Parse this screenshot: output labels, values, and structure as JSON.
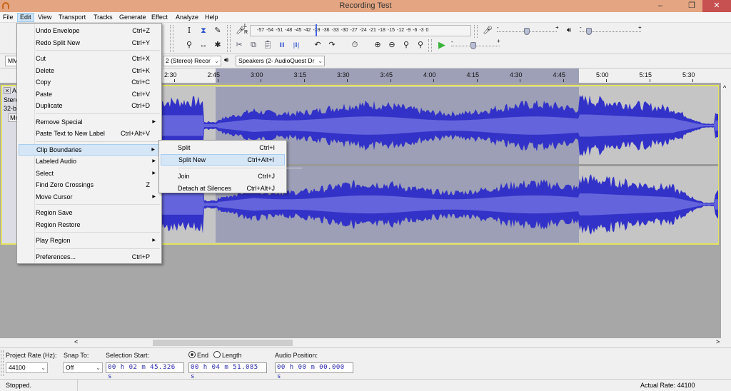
{
  "window": {
    "title": "Recording Test",
    "minimize": "–",
    "restore": "❐",
    "close": "✕"
  },
  "menubar": [
    "File",
    "Edit",
    "View",
    "Transport",
    "Tracks",
    "Generate",
    "Effect",
    "Analyze",
    "Help"
  ],
  "active_menu": "Edit",
  "edit_menu": {
    "items": [
      {
        "label": "Undo Envelope",
        "shortcut": "Ctrl+Z"
      },
      {
        "label": "Redo Split New",
        "shortcut": "Ctrl+Y"
      },
      {
        "label": "Cut",
        "shortcut": "Ctrl+X"
      },
      {
        "label": "Delete",
        "shortcut": "Ctrl+K"
      },
      {
        "label": "Copy",
        "shortcut": "Ctrl+C"
      },
      {
        "label": "Paste",
        "shortcut": "Ctrl+V"
      },
      {
        "label": "Duplicate",
        "shortcut": "Ctrl+D"
      },
      {
        "label": "Remove Special",
        "shortcut": "",
        "submenu": true
      },
      {
        "label": "Paste Text to New Label",
        "shortcut": "Ctrl+Alt+V"
      },
      {
        "label": "Clip Boundaries",
        "shortcut": "",
        "submenu": true,
        "highlighted": true
      },
      {
        "label": "Labeled Audio",
        "shortcut": "",
        "submenu": true
      },
      {
        "label": "Select",
        "shortcut": "",
        "submenu": true
      },
      {
        "label": "Find Zero Crossings",
        "shortcut": "Z"
      },
      {
        "label": "Move Cursor",
        "shortcut": "",
        "submenu": true
      },
      {
        "label": "Region Save",
        "shortcut": ""
      },
      {
        "label": "Region Restore",
        "shortcut": ""
      },
      {
        "label": "Play Region",
        "shortcut": "",
        "submenu": true
      },
      {
        "label": "Preferences...",
        "shortcut": "Ctrl+P"
      }
    ]
  },
  "clip_boundaries_submenu": {
    "items": [
      {
        "label": "Split",
        "shortcut": "Ctrl+I"
      },
      {
        "label": "Split New",
        "shortcut": "Ctrl+Alt+I",
        "highlighted": true
      },
      {
        "label": "Join",
        "shortcut": "Ctrl+J"
      },
      {
        "label": "Detach at Silences",
        "shortcut": "Ctrl+Alt+J"
      }
    ]
  },
  "toolbar": {
    "meter_scale": "-57 -54 -51 -48 -45 -42 -39 -36 -33 -30 -27 -24 -21 -18 -15 -12 -9 -6 -3 0",
    "meter_lr": {
      "l": "L",
      "r": "R"
    },
    "recording_volume": 0.5,
    "playback_volume": 0.15,
    "play_speed": 0.45,
    "slider_minus": "-",
    "slider_plus": "+"
  },
  "devices": {
    "host": "MM",
    "recording_channels": "2 (Stereo) Recor",
    "playback_device": "Speakers (2- AudioQuest Dr"
  },
  "ruler": {
    "labels": [
      "2:30",
      "2:45",
      "3:00",
      "3:15",
      "3:30",
      "3:45",
      "4:00",
      "4:15",
      "4:30",
      "4:45",
      "5:00",
      "5:15",
      "5:30"
    ]
  },
  "track": {
    "close": "×",
    "name": "A",
    "info1": "Stere",
    "info2": "32-bi",
    "mute": "Mut",
    "waveform_color": "#3232c8",
    "waveform_rms_color": "#6464dc",
    "selection_start": "2:45",
    "selection_end": "4:51"
  },
  "selection_toolbar": {
    "project_rate_label": "Project Rate (Hz):",
    "project_rate": "44100",
    "snap_to_label": "Snap To:",
    "snap_to": "Off",
    "selection_start_label": "Selection Start:",
    "selection_start": "00 h 02 m 45.326 s",
    "end_label": "End",
    "length_label": "Length",
    "end_selected": true,
    "selection_end": "00 h 04 m 51.085 s",
    "audio_position_label": "Audio Position:",
    "audio_position": "00 h 00 m 00.000 s"
  },
  "status": {
    "text": "Stopped.",
    "actual_rate": "Actual Rate: 44100"
  },
  "scroll": {
    "left": "<",
    "right": ">",
    "up": "^"
  }
}
